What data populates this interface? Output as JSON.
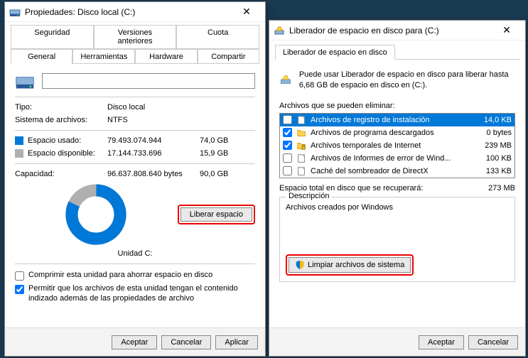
{
  "left": {
    "title": "Propiedades: Disco local (C:)",
    "tabs_row1": [
      "Seguridad",
      "Versiones anteriores",
      "Cuota"
    ],
    "tabs_row2": [
      "General",
      "Herramientas",
      "Hardware",
      "Compartir"
    ],
    "type_label": "Tipo:",
    "type_value": "Disco local",
    "fs_label": "Sistema de archivos:",
    "fs_value": "NTFS",
    "used_label": "Espacio usado:",
    "used_bytes": "79.493.074.944",
    "used_gb": "74,0 GB",
    "free_label": "Espacio disponible:",
    "free_bytes": "17.144.733.696",
    "free_gb": "15,9 GB",
    "cap_label": "Capacidad:",
    "cap_bytes": "96.637.808.640 bytes",
    "cap_gb": "90,0 GB",
    "unit_label": "Unidad C:",
    "liberar_btn": "Liberar espacio",
    "compress_label": "Comprimir esta unidad para ahorrar espacio en disco",
    "index_label": "Permitir que los archivos de esta unidad tengan el contenido indizado además de las propiedades de archivo",
    "ok": "Aceptar",
    "cancel": "Cancelar",
    "apply": "Aplicar"
  },
  "right": {
    "title": "Liberador de espacio en disco para  (C:)",
    "tab": "Liberador de espacio en disco",
    "intro": "Puede usar Liberador de espacio en disco para liberar hasta 6,68 GB de espacio en disco en  (C:).",
    "files_label": "Archivos que se pueden eliminar:",
    "files": [
      {
        "checked": false,
        "name": "Archivos de registro de instalación",
        "size": "14,0 KB",
        "selected": true,
        "icon": "file"
      },
      {
        "checked": true,
        "name": "Archivos de programa descargados",
        "size": "0 bytes",
        "selected": false,
        "icon": "folder"
      },
      {
        "checked": true,
        "name": "Archivos temporales de Internet",
        "size": "239 MB",
        "selected": false,
        "icon": "lock"
      },
      {
        "checked": false,
        "name": "Archivos de Informes de error de Wind...",
        "size": "100 KB",
        "selected": false,
        "icon": "file"
      },
      {
        "checked": false,
        "name": "Caché del sombreador de DirectX",
        "size": "133 KB",
        "selected": false,
        "icon": "file"
      }
    ],
    "total_label": "Espacio total en disco que se recuperará:",
    "total_value": "273 MB",
    "desc_group": "Descripción",
    "desc_text": "Archivos creados por Windows",
    "clean_btn": "Limpiar archivos de sistema",
    "ok": "Aceptar",
    "cancel": "Cancelar"
  },
  "chart_data": {
    "type": "pie",
    "title": "Unidad C:",
    "series": [
      {
        "name": "Espacio usado",
        "value": 74.0,
        "color": "#0078d7"
      },
      {
        "name": "Espacio disponible",
        "value": 15.9,
        "color": "#b0b0b0"
      }
    ],
    "unit": "GB",
    "total": 90.0
  }
}
